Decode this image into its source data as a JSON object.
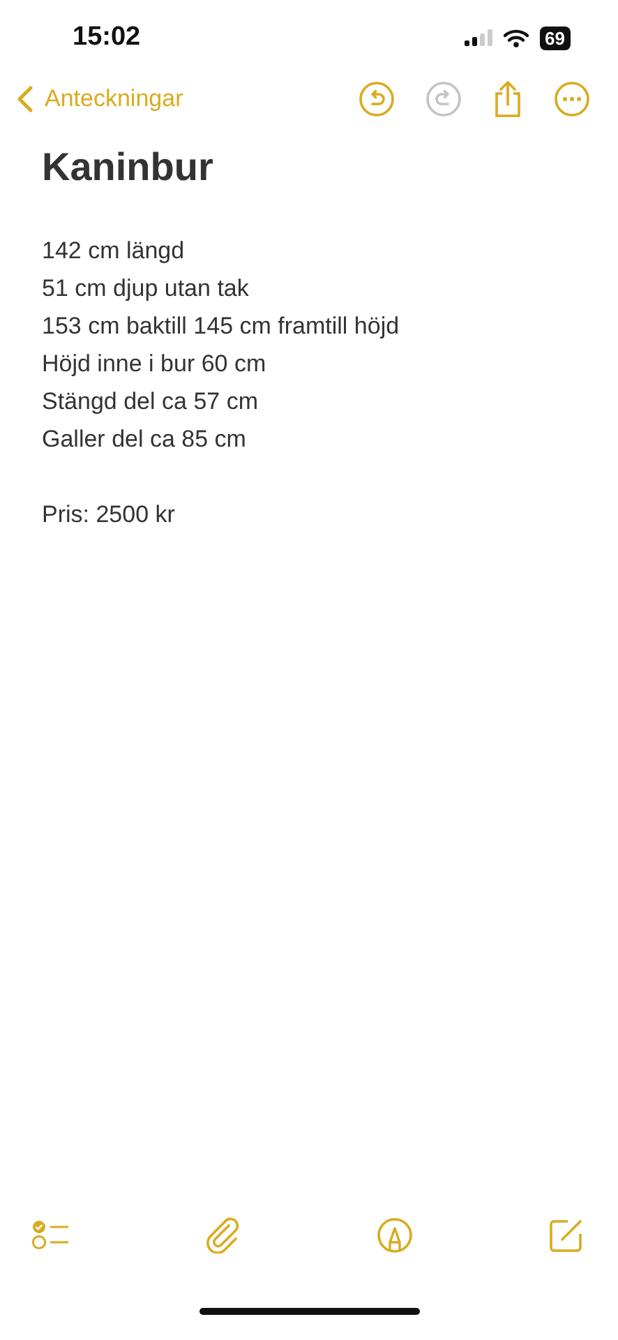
{
  "status_bar": {
    "time": "15:02",
    "battery": "69"
  },
  "nav": {
    "back_label": "Anteckningar",
    "undo": {
      "disabled": false
    },
    "redo": {
      "disabled": true
    }
  },
  "note": {
    "title": "Kaninbur",
    "paragraphs": [
      {
        "lines": [
          "142 cm längd",
          "51 cm djup utan tak",
          "153 cm baktill 145 cm framtill höjd",
          "Höjd inne i bur 60 cm",
          "Stängd del ca 57 cm",
          "Galler del ca 85 cm"
        ]
      },
      {
        "lines": [
          "Pris: 2500 kr"
        ]
      }
    ]
  },
  "toolbar": [
    {
      "kind": "checklist"
    },
    {
      "kind": "attach"
    },
    {
      "kind": "markup"
    },
    {
      "kind": "compose"
    }
  ]
}
